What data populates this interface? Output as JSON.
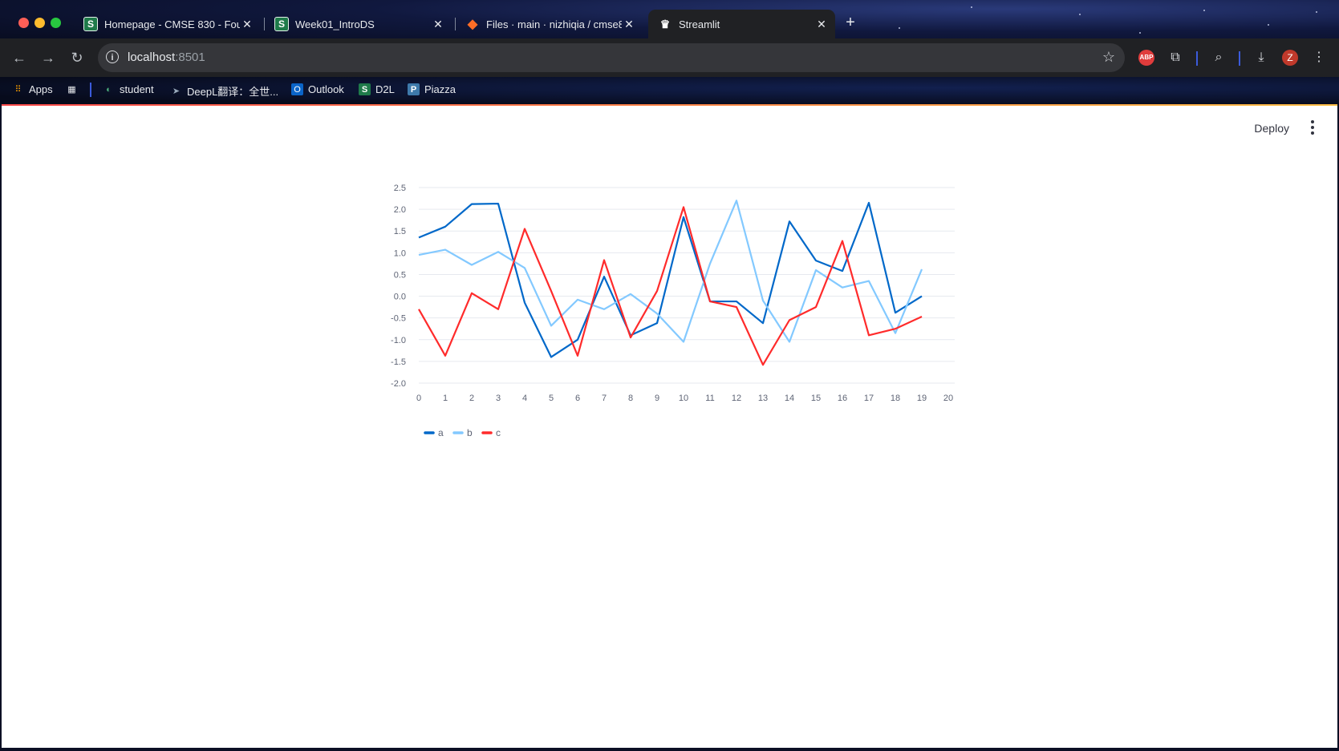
{
  "browser": {
    "tabs": [
      {
        "title": "Homepage - CMSE 830 - Fou",
        "favicon": "S"
      },
      {
        "title": "Week01_IntroDS",
        "favicon": "S"
      },
      {
        "title": "Files · main · nizhiqia / cmse8",
        "favicon": "gitlab-icon"
      },
      {
        "title": "Streamlit",
        "favicon": "streamlit-crown-icon"
      }
    ],
    "address": {
      "host": "localhost",
      "port": ":8501"
    },
    "bookmarks": [
      {
        "label": "Apps"
      },
      {
        "label": "student"
      },
      {
        "label": "DeepL翻译：全世..."
      },
      {
        "label": "Outlook"
      },
      {
        "label": "D2L"
      },
      {
        "label": "Piazza"
      }
    ],
    "profile_initial": "Z",
    "abp_label": "ABP"
  },
  "app": {
    "deploy_label": "Deploy"
  },
  "chart_data": {
    "type": "line",
    "x": [
      0,
      1,
      2,
      3,
      4,
      5,
      6,
      7,
      8,
      9,
      10,
      11,
      12,
      13,
      14,
      15,
      16,
      17,
      18,
      19
    ],
    "xlim": [
      0,
      20
    ],
    "xticks": [
      "0",
      "1",
      "2",
      "3",
      "4",
      "5",
      "6",
      "7",
      "8",
      "9",
      "10",
      "11",
      "12",
      "13",
      "14",
      "15",
      "16",
      "17",
      "18",
      "19",
      "20"
    ],
    "ylim": [
      -2.0,
      2.5
    ],
    "yticks": [
      "2.5",
      "2.0",
      "1.5",
      "1.0",
      "0.5",
      "0.0",
      "-0.5",
      "-1.0",
      "-1.5",
      "-2.0"
    ],
    "grid": true,
    "legend": "bottom-left",
    "series": [
      {
        "name": "a",
        "color": "#0068c9",
        "values": [
          1.35,
          1.6,
          2.12,
          2.13,
          -0.15,
          -1.4,
          -1.0,
          0.45,
          -0.9,
          -0.62,
          1.82,
          -0.12,
          -0.12,
          -0.62,
          1.72,
          0.82,
          0.58,
          2.15,
          -0.38,
          0.0
        ]
      },
      {
        "name": "b",
        "color": "#83c9ff",
        "values": [
          0.95,
          1.07,
          0.72,
          1.02,
          0.65,
          -0.68,
          -0.08,
          -0.3,
          0.05,
          -0.4,
          -1.05,
          0.75,
          2.2,
          -0.1,
          -1.05,
          0.6,
          0.2,
          0.35,
          -0.85,
          0.62
        ]
      },
      {
        "name": "c",
        "color": "#ff2b2b",
        "values": [
          -0.3,
          -1.37,
          0.07,
          -0.3,
          1.55,
          0.12,
          -1.37,
          0.83,
          -0.95,
          0.12,
          2.05,
          -0.12,
          -0.25,
          -1.58,
          -0.55,
          -0.25,
          1.27,
          -0.9,
          -0.75,
          -0.47
        ]
      }
    ]
  }
}
